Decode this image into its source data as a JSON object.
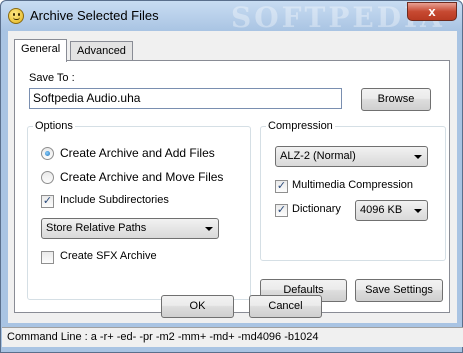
{
  "window": {
    "title": "Archive Selected Files",
    "watermark": "SOFTPEDIA",
    "close_glyph": "x"
  },
  "tabs": [
    {
      "label": "General",
      "active": true
    },
    {
      "label": "Advanced",
      "active": false
    }
  ],
  "save_to": {
    "label": "Save To :",
    "value": "Softpedia Audio.uha",
    "browse_label": "Browse"
  },
  "options": {
    "title": "Options",
    "create_add_label": "Create Archive and Add Files",
    "create_add_checked": true,
    "create_move_label": "Create Archive and Move Files",
    "create_move_checked": false,
    "include_subdirs_label": "Include Subdirectories",
    "include_subdirs_checked": true,
    "path_mode": "Store Relative Paths",
    "sfx_label": "Create SFX Archive",
    "sfx_checked": false
  },
  "compression": {
    "title": "Compression",
    "method": "ALZ-2 (Normal)",
    "multimedia_label": "Multimedia Compression",
    "multimedia_checked": true,
    "dictionary_label": "Dictionary",
    "dictionary_checked": true,
    "dictionary_size": "4096 KB"
  },
  "buttons": {
    "defaults": "Defaults",
    "save_settings": "Save Settings",
    "ok": "OK",
    "cancel": "Cancel"
  },
  "status": {
    "command_line": "Command Line : a -r+ -ed- -pr -m2 -mm+ -md+ -md4096 -b1024"
  },
  "icons": {
    "app": "smiley-icon",
    "checkmark": "✓"
  }
}
